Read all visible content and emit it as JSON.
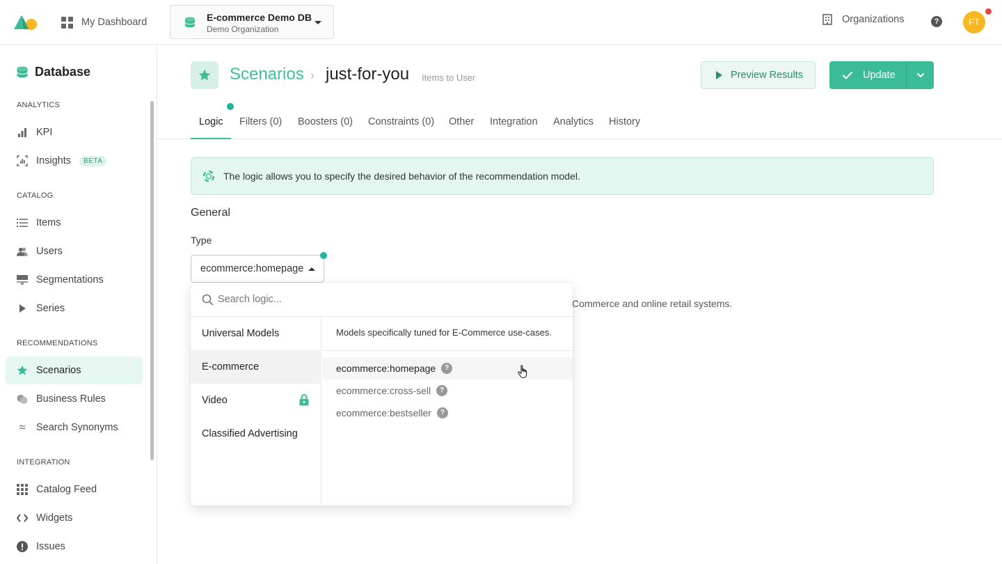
{
  "topbar": {
    "dashboard_label": "My Dashboard",
    "db_name": "E-commerce Demo DB",
    "db_org": "Demo Organization",
    "organizations_label": "Organizations",
    "help_label": "?",
    "avatar_initials": "FT"
  },
  "sidebar": {
    "title": "Database",
    "sections": {
      "analytics": "ANALYTICS",
      "catalog": "CATALOG",
      "recommendations": "RECOMMENDATIONS",
      "integration": "INTEGRATION"
    },
    "items": {
      "kpi": "KPI",
      "insights": "Insights",
      "insights_badge": "BETA",
      "items": "Items",
      "users": "Users",
      "segmentations": "Segmentations",
      "series": "Series",
      "scenarios": "Scenarios",
      "business_rules": "Business Rules",
      "search_synonyms": "Search Synonyms",
      "catalog_feed": "Catalog Feed",
      "widgets": "Widgets",
      "issues": "Issues"
    },
    "active_item": "Scenarios"
  },
  "header": {
    "breadcrumb_root": "Scenarios",
    "separator": "›",
    "scenario_name": "just-for-you",
    "scenario_type": "Items to User",
    "preview_label": "Preview Results",
    "update_label": "Update"
  },
  "tabs": [
    {
      "label": "Logic"
    },
    {
      "label": "Filters (0)"
    },
    {
      "label": "Boosters (0)"
    },
    {
      "label": "Constraints (0)"
    },
    {
      "label": "Other"
    },
    {
      "label": "Integration"
    },
    {
      "label": "Analytics"
    },
    {
      "label": "History"
    }
  ],
  "active_tab": "Logic",
  "banner": {
    "text": "The logic allows you to specify the desired behavior of the recommendation model."
  },
  "general": {
    "heading": "General",
    "type_label": "Type",
    "type_value": "ecommerce:homepage",
    "behind_text": "Commerce and online retail systems."
  },
  "dropdown": {
    "search_placeholder": "Search logic...",
    "categories": [
      {
        "label": "Universal Models"
      },
      {
        "label": "E-commerce"
      },
      {
        "label": "Video"
      },
      {
        "label": "Classified Advertising"
      }
    ],
    "active_category": "E-commerce",
    "description": "Models specifically tuned for E-Commerce use-cases.",
    "options": [
      {
        "label": "ecommerce:homepage"
      },
      {
        "label": "ecommerce:cross-sell"
      },
      {
        "label": "ecommerce:bestseller"
      }
    ],
    "active_option": "ecommerce:homepage"
  },
  "colors": {
    "accent": "#3cbc96",
    "accent_light": "#e3f6f0",
    "avatar": "#f9b623",
    "notification": "#f0453e"
  }
}
